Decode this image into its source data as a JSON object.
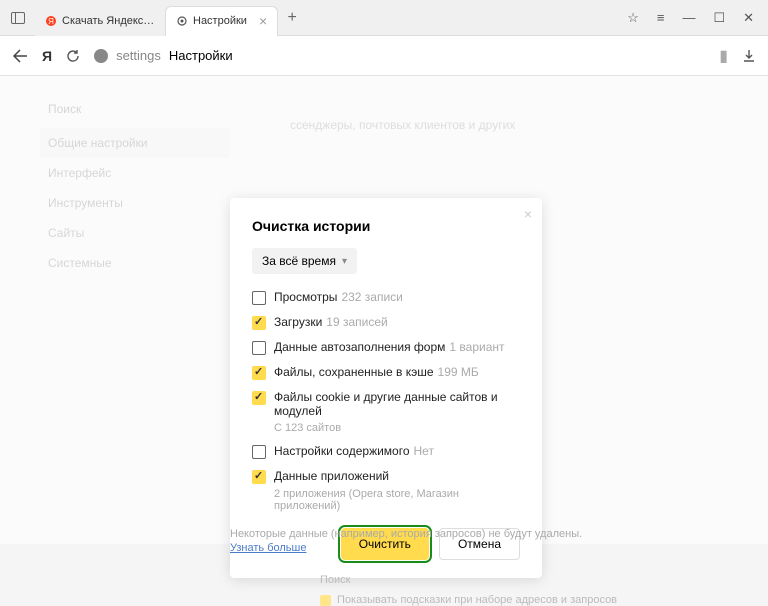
{
  "tabs": {
    "inactive": "Скачать Яндекс.Браузер д",
    "active": "Настройки"
  },
  "address": {
    "path": "settings",
    "title": "Настройки"
  },
  "sidebar": {
    "heading": "Поиск",
    "items": [
      "Общие настройки",
      "Интерфейс",
      "Инструменты",
      "Сайты",
      "Системные"
    ]
  },
  "content_hint": "ссенджеры, почтовых клиентов и других",
  "dialog": {
    "title": "Очистка истории",
    "range": "За всё время",
    "items": [
      {
        "checked": false,
        "label": "Просмотры",
        "sub": "232 записи"
      },
      {
        "checked": true,
        "label": "Загрузки",
        "sub": "19 записей"
      },
      {
        "checked": false,
        "label": "Данные автозаполнения форм",
        "sub": "1 вариант"
      },
      {
        "checked": true,
        "label": "Файлы, сохраненные в кэше",
        "sub": "199 МБ"
      },
      {
        "checked": true,
        "label": "Файлы cookie и другие данные сайтов и модулей",
        "subline": "С 123 сайтов"
      },
      {
        "checked": false,
        "label": "Настройки содержимого",
        "sub": "Нет"
      },
      {
        "checked": true,
        "label": "Данные приложений",
        "subline": "2 приложения (Opera store, Магазин приложений)"
      }
    ],
    "clear": "Очистить",
    "cancel": "Отмена"
  },
  "footer": {
    "text": "Некоторые данные (например, история запросов) не будут удалены.",
    "link": "Узнать больше"
  },
  "bottom": {
    "heading": "Поиск",
    "hint": "Показывать подсказки при наборе адресов и запросов"
  }
}
